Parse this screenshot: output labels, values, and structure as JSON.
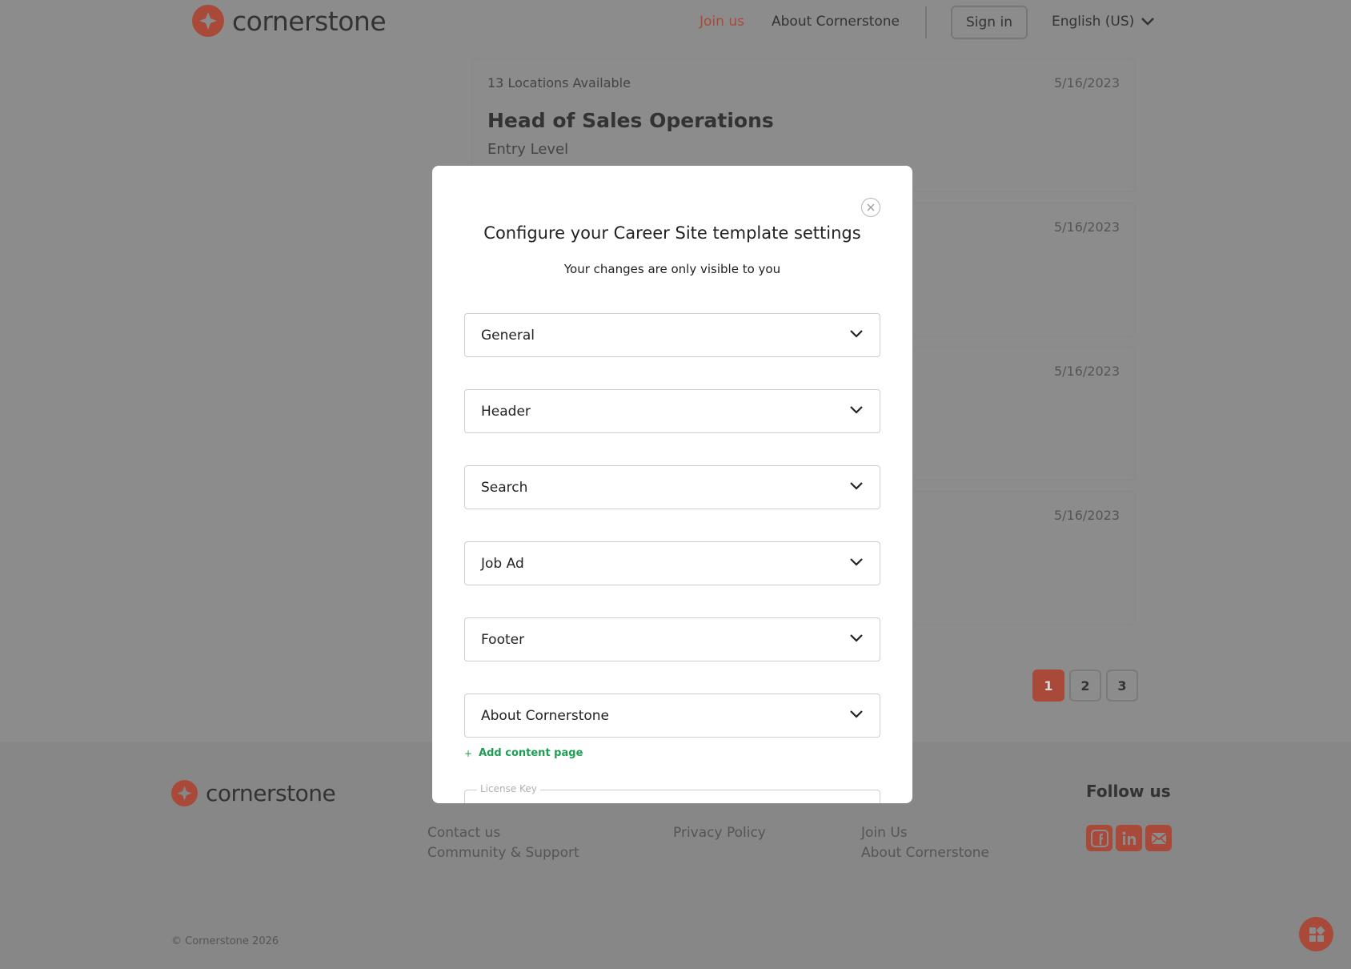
{
  "header": {
    "brand": "cornerstone",
    "nav": {
      "join": "Join us",
      "about": "About Cornerstone"
    },
    "signin": "Sign in",
    "language": "English (US)"
  },
  "jobs": [
    {
      "locations": "13 Locations Available",
      "date": "5/16/2023",
      "title": "Head of Sales Operations",
      "level": "Entry Level"
    },
    {
      "date": "5/16/2023"
    },
    {
      "date": "5/16/2023"
    },
    {
      "date": "5/16/2023"
    }
  ],
  "pagination": {
    "pages": [
      "1",
      "2",
      "3"
    ],
    "current": "1"
  },
  "modal": {
    "title": "Configure your Career Site template settings",
    "subtitle": "Your changes are only visible to you",
    "sections": [
      "General",
      "Header",
      "Search",
      "Job Ad",
      "Footer",
      "About Cornerstone"
    ],
    "add_content_page": "Add content page",
    "license_key_label": "License Key"
  },
  "footer": {
    "brand": "cornerstone",
    "col1": {
      "links": [
        "Contact us",
        "Community & Support"
      ]
    },
    "col2": {
      "links": [
        "Privacy Policy"
      ]
    },
    "col3": {
      "links": [
        "Join Us",
        "About Cornerstone"
      ]
    },
    "follow_heading": "Follow us",
    "social_icons": [
      "facebook-icon",
      "linkedin-icon",
      "email-icon"
    ],
    "copyright": "© Cornerstone 2026"
  },
  "colors": {
    "brand": "#a9493a",
    "accent_green": "#1e9e53",
    "overlay_bg": "#8c8c8c"
  }
}
